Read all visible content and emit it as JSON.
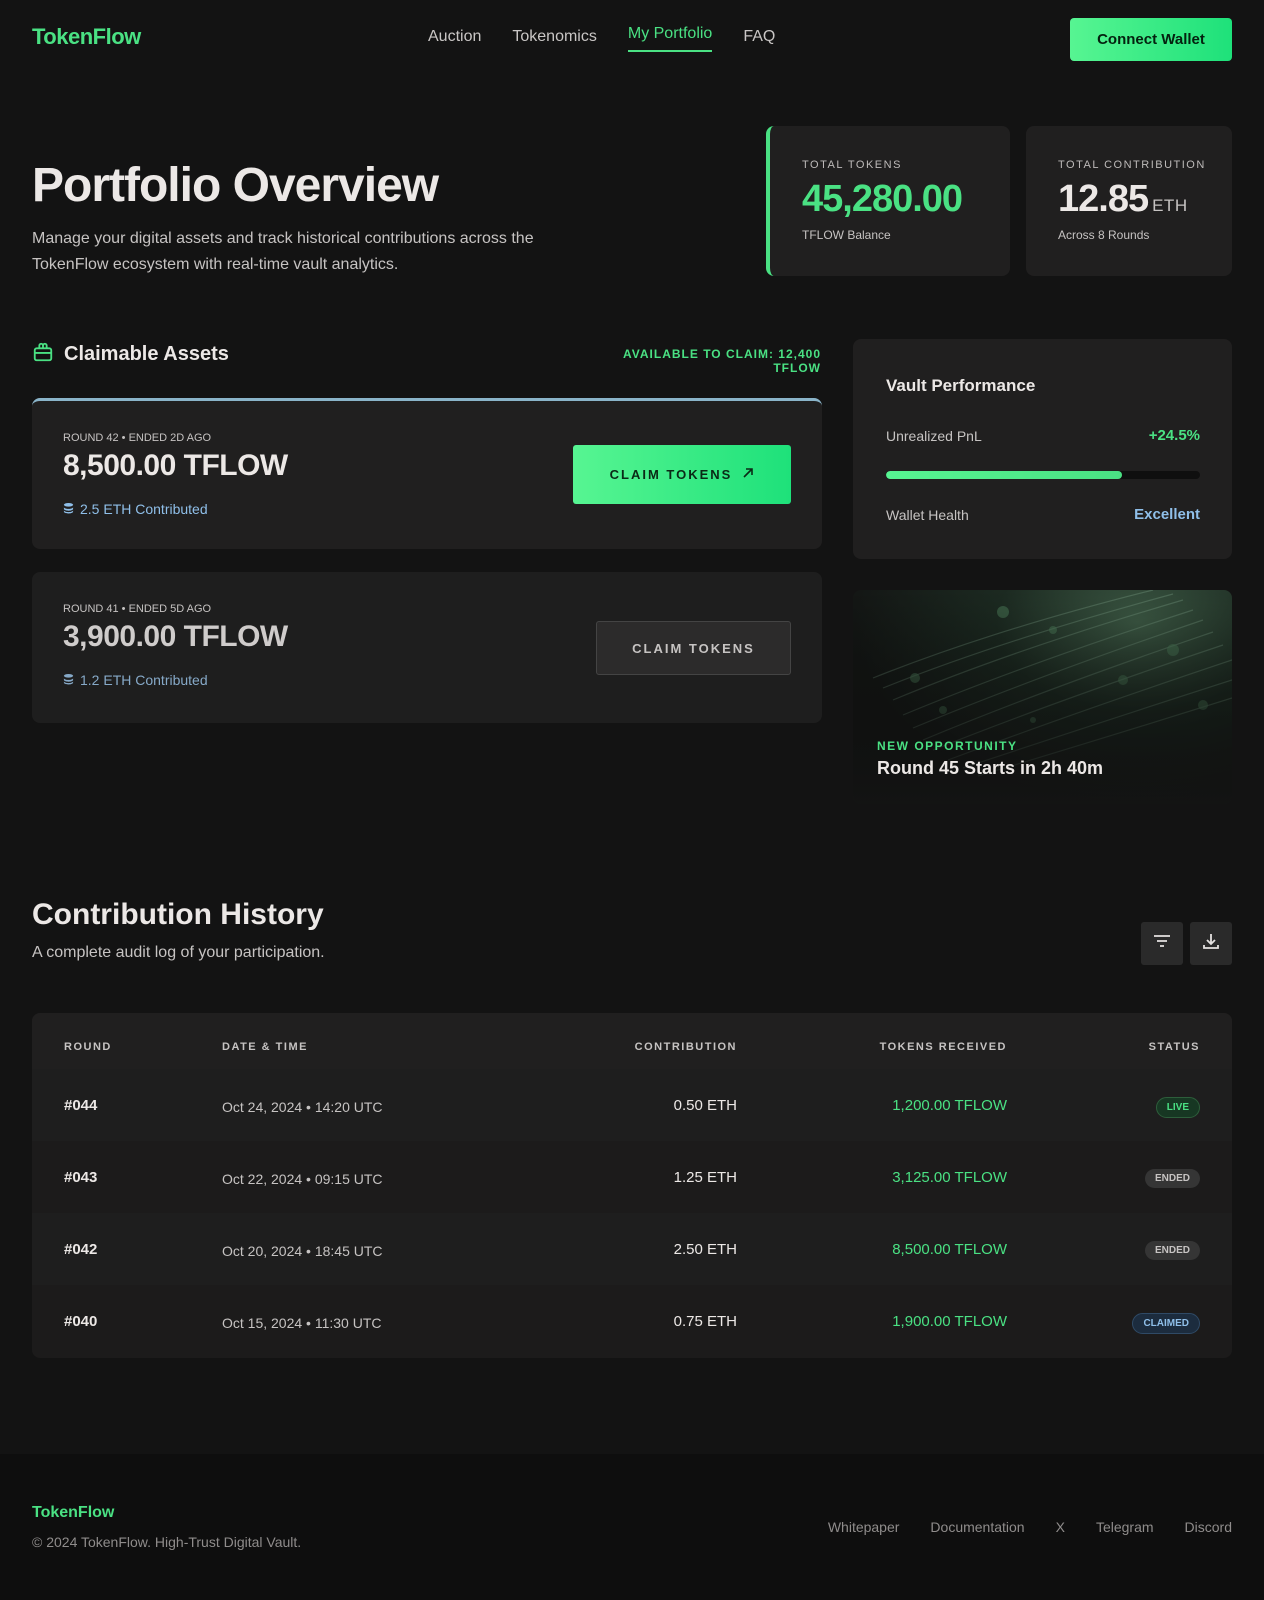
{
  "header": {
    "logo": "TokenFlow",
    "nav": [
      {
        "label": "Auction",
        "active": false
      },
      {
        "label": "Tokenomics",
        "active": false
      },
      {
        "label": "My Portfolio",
        "active": true
      },
      {
        "label": "FAQ",
        "active": false
      }
    ],
    "connect_label": "Connect Wallet"
  },
  "hero": {
    "title": "Portfolio Overview",
    "description": "Manage your digital assets and track historical contributions across the TokenFlow ecosystem with real-time vault analytics."
  },
  "stats": {
    "tokens": {
      "label": "TOTAL TOKENS",
      "value": "45,280.00",
      "sub": "TFLOW Balance"
    },
    "contribution": {
      "label": "TOTAL CONTRIBUTION",
      "value": "12.85",
      "unit": "ETH",
      "sub": "Across 8 Rounds"
    }
  },
  "claimable": {
    "title": "Claimable Assets",
    "icon": "gift-icon",
    "available": "AVAILABLE TO CLAIM: 12,400 TFLOW",
    "cards": [
      {
        "meta": "ROUND 42 • ENDED 2D AGO",
        "amount": "8,500.00 TFLOW",
        "contributed": "2.5 ETH Contributed",
        "button": "CLAIM TOKENS"
      },
      {
        "meta": "ROUND 41 • ENDED 5D AGO",
        "amount": "3,900.00 TFLOW",
        "contributed": "1.2 ETH Contributed",
        "button": "CLAIM TOKENS"
      }
    ]
  },
  "vault": {
    "title": "Vault Performance",
    "pnl_label": "Unrealized PnL",
    "pnl_value": "+24.5%",
    "progress_fraction": 0.75,
    "health_label": "Wallet Health",
    "health_value": "Excellent"
  },
  "promo": {
    "label": "NEW OPPORTUNITY",
    "title": "Round 45 Starts in 2h 40m"
  },
  "history": {
    "title": "Contribution History",
    "description": "A complete audit log of your participation.",
    "columns": [
      "ROUND",
      "DATE & TIME",
      "CONTRIBUTION",
      "TOKENS RECEIVED",
      "STATUS"
    ],
    "rows": [
      {
        "round": "#044",
        "date": "Oct 24, 2024 • 14:20 UTC",
        "contribution": "0.50 ETH",
        "tokens": "1,200.00 TFLOW",
        "status": "LIVE"
      },
      {
        "round": "#043",
        "date": "Oct 22, 2024 • 09:15 UTC",
        "contribution": "1.25 ETH",
        "tokens": "3,125.00 TFLOW",
        "status": "ENDED"
      },
      {
        "round": "#042",
        "date": "Oct 20, 2024 • 18:45 UTC",
        "contribution": "2.50 ETH",
        "tokens": "8,500.00 TFLOW",
        "status": "ENDED"
      },
      {
        "round": "#040",
        "date": "Oct 15, 2024 • 11:30 UTC",
        "contribution": "0.75 ETH",
        "tokens": "1,900.00 TFLOW",
        "status": "CLAIMED"
      }
    ]
  },
  "footer": {
    "logo": "TokenFlow",
    "copyright": "© 2024 TokenFlow. High-Trust Digital Vault.",
    "links": [
      "Whitepaper",
      "Documentation",
      "X",
      "Telegram",
      "Discord"
    ]
  },
  "colors": {
    "accent": "#4ae183",
    "background": "#131313",
    "card": "#201f1f",
    "info": "#8fbfe9"
  }
}
